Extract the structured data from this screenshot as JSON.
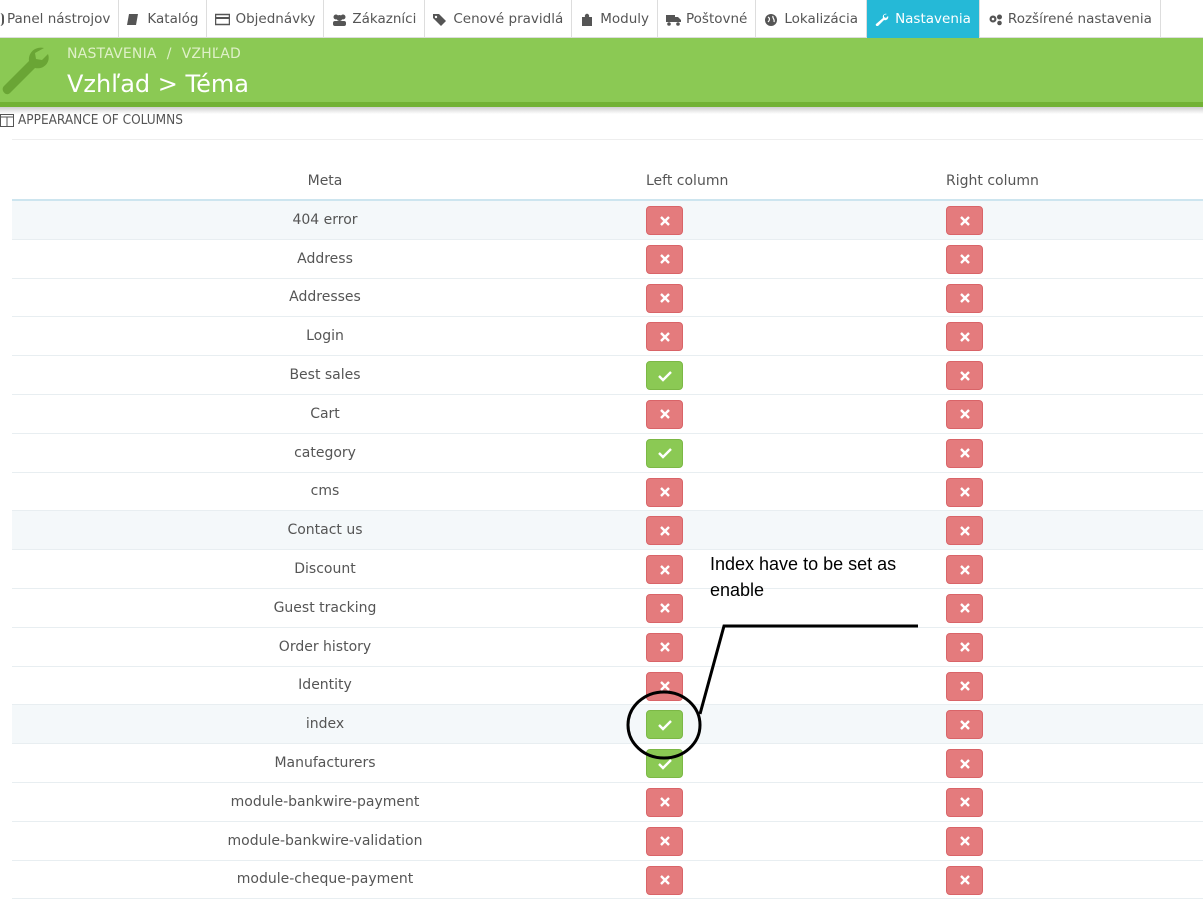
{
  "topnav": {
    "tabs": [
      {
        "label": "Panel nástrojov",
        "icon": "dashboard-icon",
        "active": false
      },
      {
        "label": "Katalóg",
        "icon": "book-icon",
        "active": false
      },
      {
        "label": "Objednávky",
        "icon": "credit-card-icon",
        "active": false
      },
      {
        "label": "Zákazníci",
        "icon": "users-icon",
        "active": false
      },
      {
        "label": "Cenové pravidlá",
        "icon": "tags-icon",
        "active": false
      },
      {
        "label": "Moduly",
        "icon": "puzzle-icon",
        "active": false
      },
      {
        "label": "Poštovné",
        "icon": "truck-icon",
        "active": false
      },
      {
        "label": "Lokalizácia",
        "icon": "globe-icon",
        "active": false
      },
      {
        "label": "Nastavenia",
        "icon": "wrench-icon",
        "active": true
      },
      {
        "label": "Rozšírené nastavenia",
        "icon": "cogs-icon",
        "active": false
      }
    ]
  },
  "header": {
    "breadcrumb": [
      "NASTAVENIA",
      "VZHĽAD"
    ],
    "breadcrumb_sep": "/",
    "title": "Vzhľad > Téma",
    "icon": "wrench-icon"
  },
  "panel": {
    "heading": "APPEARANCE OF COLUMNS",
    "icon": "columns-icon"
  },
  "table": {
    "headers": {
      "meta": "Meta",
      "left": "Left column",
      "right": "Right column"
    },
    "rows": [
      {
        "meta": "404 error",
        "left": false,
        "right": false
      },
      {
        "meta": "Address",
        "left": false,
        "right": false
      },
      {
        "meta": "Addresses",
        "left": false,
        "right": false
      },
      {
        "meta": "Login",
        "left": false,
        "right": false
      },
      {
        "meta": "Best sales",
        "left": true,
        "right": false
      },
      {
        "meta": "Cart",
        "left": false,
        "right": false
      },
      {
        "meta": "category",
        "left": true,
        "right": false
      },
      {
        "meta": "cms",
        "left": false,
        "right": false
      },
      {
        "meta": "Contact us",
        "left": false,
        "right": false
      },
      {
        "meta": "Discount",
        "left": false,
        "right": false
      },
      {
        "meta": "Guest tracking",
        "left": false,
        "right": false
      },
      {
        "meta": "Order history",
        "left": false,
        "right": false
      },
      {
        "meta": "Identity",
        "left": false,
        "right": false
      },
      {
        "meta": "index",
        "left": true,
        "right": false
      },
      {
        "meta": "Manufacturers",
        "left": true,
        "right": false
      },
      {
        "meta": "module-bankwire-payment",
        "left": false,
        "right": false
      },
      {
        "meta": "module-bankwire-validation",
        "left": false,
        "right": false
      },
      {
        "meta": "module-cheque-payment",
        "left": false,
        "right": false
      }
    ]
  },
  "annotation": {
    "text": "Index have to be set as enable"
  },
  "colors": {
    "nav_active": "#25b9d7",
    "header_green": "#8bc954",
    "enabled_green": "#8bc954",
    "disabled_red": "#e47b7d"
  }
}
